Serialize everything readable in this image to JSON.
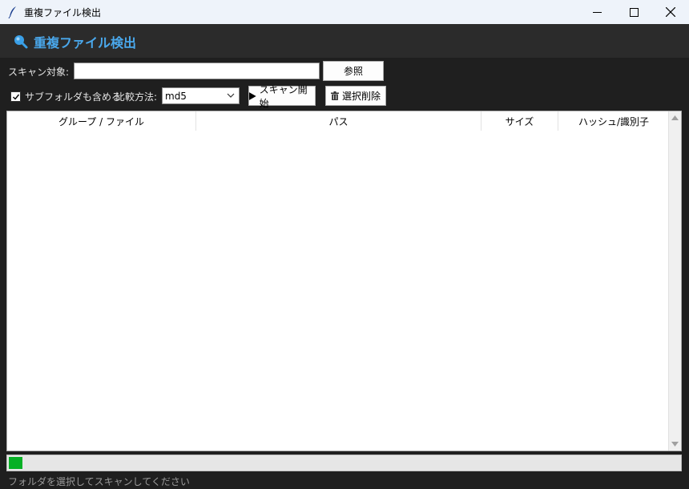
{
  "window": {
    "title": "重複ファイル検出",
    "controls": {
      "minimize": "minimize-icon",
      "maximize": "maximize-icon",
      "close": "close-icon"
    }
  },
  "header": {
    "icon": "search-icon",
    "title": "重複ファイル検出"
  },
  "scan": {
    "target_label": "スキャン対象:",
    "target_value": "",
    "browse_label": "参照"
  },
  "options": {
    "include_subfolders_label": "サブフォルダも含める",
    "include_subfolders_checked": true,
    "compare_label": "比較方法:",
    "compare_value": "md5",
    "start_label": "スキャン開始",
    "start_icon": "play-icon",
    "delete_label": "選択削除",
    "delete_icon": "trash-icon"
  },
  "table": {
    "columns": [
      "グループ / ファイル",
      "パス",
      "サイズ",
      "ハッシュ/識別子"
    ],
    "rows": []
  },
  "progress": {
    "value": 0.02,
    "color": "#06b025"
  },
  "status": {
    "text": "フォルダを選択してスキャンしてください"
  },
  "colors": {
    "accent": "#4aa8ec",
    "background": "#1f1f1f",
    "header_bg": "#2b2b2b"
  }
}
